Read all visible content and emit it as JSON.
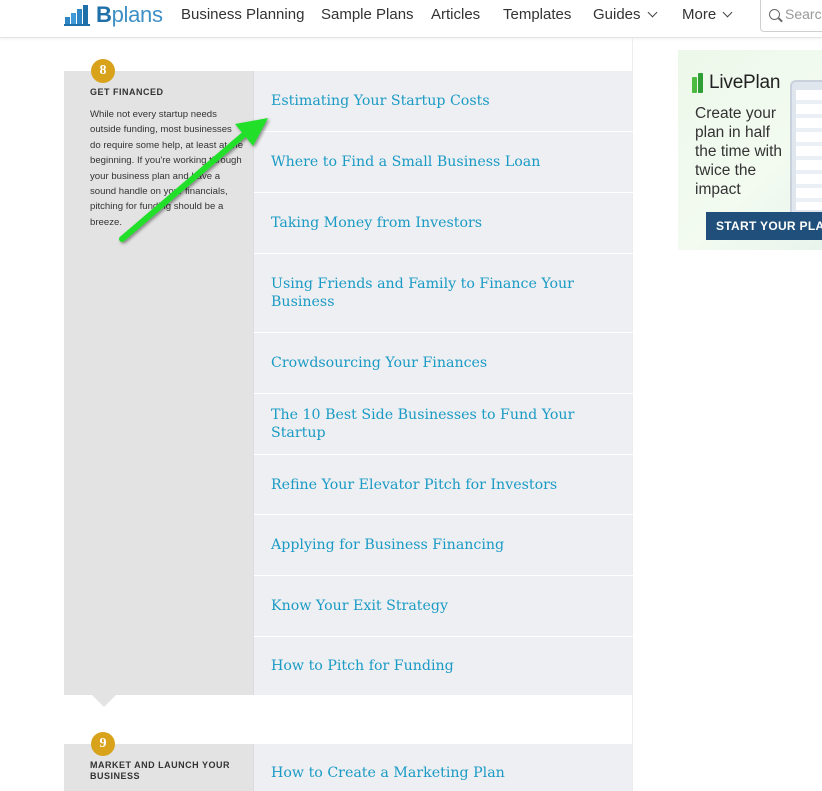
{
  "header": {
    "logo_text_bold": "B",
    "logo_text_rest": "plans",
    "nav": [
      {
        "label": "Business Planning"
      },
      {
        "label": "Sample Plans"
      },
      {
        "label": "Articles"
      },
      {
        "label": "Templates"
      },
      {
        "label": "Guides"
      },
      {
        "label": "More"
      }
    ],
    "search": {
      "placeholder": "Search"
    }
  },
  "steps": [
    {
      "number": "8",
      "title": "GET FINANCED",
      "description": "While not every startup needs outside funding, most businesses do require some help, at least at the beginning. If you're working through your business plan and have a sound handle on your financials, pitching for funding should be a breeze.",
      "links": [
        "Estimating Your Startup Costs",
        "Where to Find a Small Business Loan",
        "Taking Money from Investors",
        "Using Friends and Family to Finance Your Business",
        "Crowdsourcing Your Finances",
        "The 10 Best Side Businesses to Fund Your Startup",
        "Refine Your Elevator Pitch for Investors",
        "Applying for Business Financing",
        "Know Your Exit Strategy",
        "How to Pitch for Funding"
      ]
    },
    {
      "number": "9",
      "title": "MARKET AND LAUNCH YOUR BUSINESS",
      "links": [
        "How to Create a Marketing Plan"
      ]
    }
  ],
  "ad": {
    "brand": "LivePlan",
    "tagline": "Create your plan in half the time with twice the impact",
    "cta": "START YOUR PLAN"
  },
  "colors": {
    "link": "#1a9bc5",
    "badge": "#d8a21b",
    "arrow": "#22e02a",
    "ad_button": "#1f4f7a"
  }
}
